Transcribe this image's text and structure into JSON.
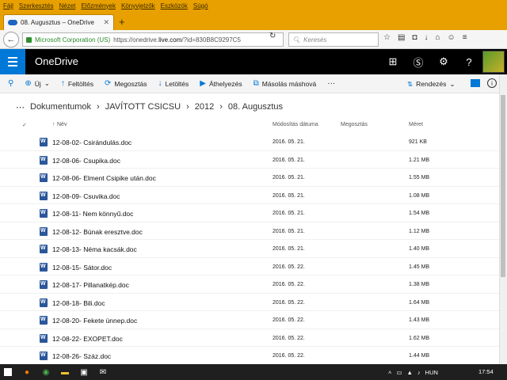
{
  "browser": {
    "menu": [
      "Fájl",
      "Szerkesztés",
      "Nézet",
      "Előzmények",
      "Könyvjelzők",
      "Eszközök",
      "Súgó"
    ],
    "tab_title": "08. Augusztus – OneDrive",
    "cert_name": "Microsoft Corporation (US)",
    "url_prefix": "https://onedrive.",
    "url_host": "live.com",
    "url_suffix": "/?id=830B8C9297C5",
    "search_placeholder": "Keresés"
  },
  "app": {
    "brand": "OneDrive"
  },
  "commands": {
    "new": "Új",
    "upload": "Feltöltés",
    "share": "Megosztás",
    "download": "Letöltés",
    "move": "Áthelyezés",
    "copy": "Másolás máshová",
    "more": "···",
    "sort": "Rendezés"
  },
  "breadcrumb": [
    "Dokumentumok",
    "JAVÍTOTT CSICSU",
    "2012",
    "08. Augusztus"
  ],
  "columns": {
    "name": "Név",
    "modified": "Módosítás dátuma",
    "sharing": "Megosztás",
    "size": "Méret"
  },
  "files": [
    {
      "name": "12-08-02- Csirándulás.doc",
      "date": "2016. 05. 21.",
      "size": "921 KB"
    },
    {
      "name": "12-08-06- Csupika.doc",
      "date": "2016. 05. 21.",
      "size": "1.21 MB"
    },
    {
      "name": "12-08-06- Elment Csipike után.doc",
      "date": "2016. 05. 21.",
      "size": "1.55 MB"
    },
    {
      "name": "12-08-09- Csuvika.doc",
      "date": "2016. 05. 21.",
      "size": "1.08 MB"
    },
    {
      "name": "12-08-11- Nem könnyű.doc",
      "date": "2016. 05. 21.",
      "size": "1.54 MB"
    },
    {
      "name": "12-08-12- Búnak eresztve.doc",
      "date": "2016. 05. 21.",
      "size": "1.12 MB"
    },
    {
      "name": "12-08-13- Néma kacsák.doc",
      "date": "2016. 05. 21.",
      "size": "1.40 MB"
    },
    {
      "name": "12-08-15- Sátor.doc",
      "date": "2016. 05. 22.",
      "size": "1.45 MB"
    },
    {
      "name": "12-08-17- Pillanatkép.doc",
      "date": "2016. 05. 22.",
      "size": "1.38 MB"
    },
    {
      "name": "12-08-18- Bili.doc",
      "date": "2016. 05. 22.",
      "size": "1.64 MB"
    },
    {
      "name": "12-08-20- Fekete ünnep.doc",
      "date": "2016. 05. 22.",
      "size": "1.43 MB"
    },
    {
      "name": "12-08-22- EXOPET.doc",
      "date": "2016. 05. 22.",
      "size": "1.62 MB"
    },
    {
      "name": "12-08-26- Száz.doc",
      "date": "2016. 05. 22.",
      "size": "1.44 MB"
    }
  ],
  "taskbar": {
    "language": "HUN",
    "time": "17:54"
  }
}
